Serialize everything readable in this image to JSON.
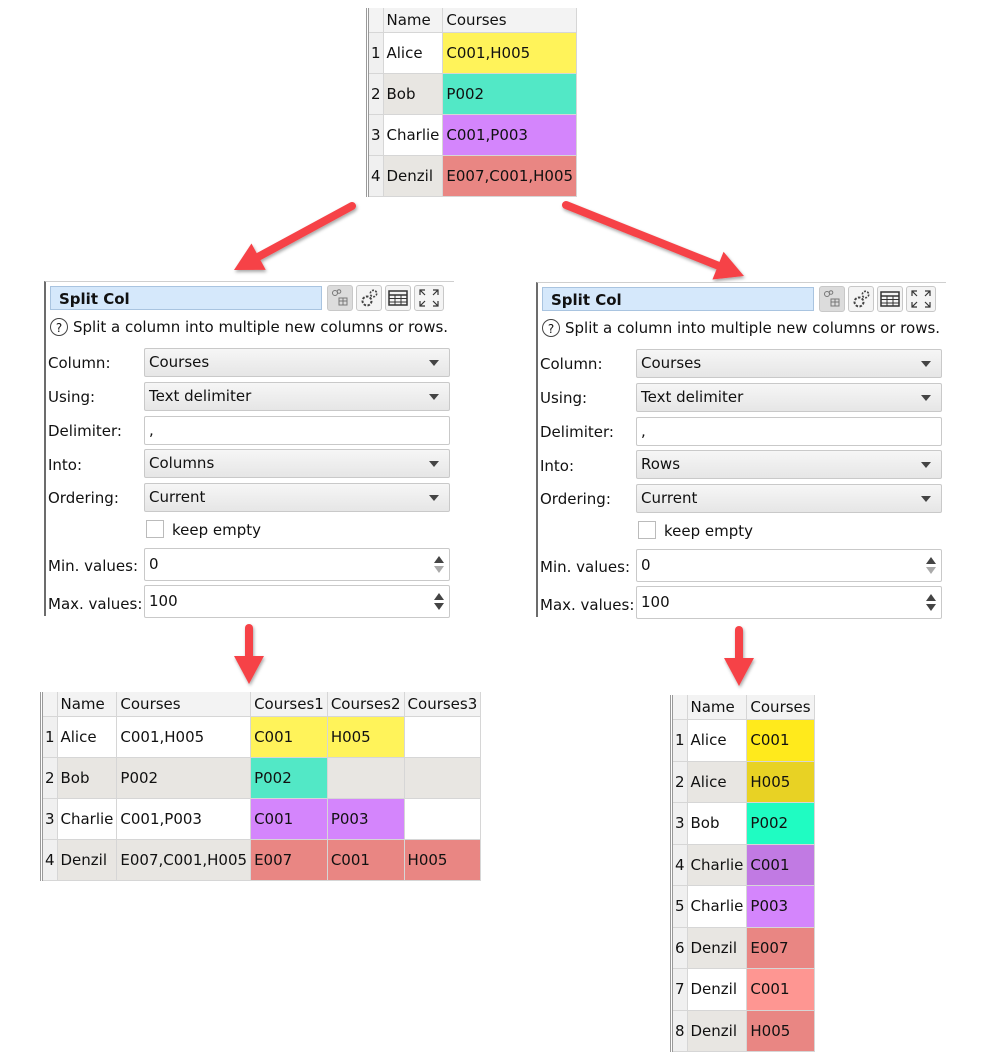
{
  "source_table": {
    "columns": [
      "Name",
      "Courses"
    ],
    "rows": [
      {
        "n": "1",
        "name": "Alice",
        "courses": "C001,H005",
        "color": "#fff35a"
      },
      {
        "n": "2",
        "name": "Bob",
        "courses": "P002",
        "color": "#52e8c6"
      },
      {
        "n": "3",
        "name": "Charlie",
        "courses": "C001,P003",
        "color": "#d485fc"
      },
      {
        "n": "4",
        "name": "Denzil",
        "courses": "E007,C001,H005",
        "color": "#e98683"
      }
    ]
  },
  "dialog_columns": {
    "title": "Split Col",
    "description": "Split a column into multiple new columns or rows.",
    "labels": {
      "column": "Column:",
      "using": "Using:",
      "delimiter": "Delimiter:",
      "into": "Into:",
      "ordering": "Ordering:",
      "min": "Min. values:",
      "max": "Max. values:"
    },
    "column_value": "Courses",
    "using_value": "Text delimiter",
    "delimiter_value": ",",
    "into_value": "Columns",
    "ordering_value": "Current",
    "keep_empty_label": "keep empty",
    "keep_empty_checked": false,
    "min_value": "0",
    "max_value": "100"
  },
  "dialog_rows": {
    "title": "Split Col",
    "description": "Split a column into multiple new columns or rows.",
    "labels": {
      "column": "Column:",
      "using": "Using:",
      "delimiter": "Delimiter:",
      "into": "Into:",
      "ordering": "Ordering:",
      "min": "Min. values:",
      "max": "Max. values:"
    },
    "column_value": "Courses",
    "using_value": "Text delimiter",
    "delimiter_value": ",",
    "into_value": "Rows",
    "ordering_value": "Current",
    "keep_empty_label": "keep empty",
    "keep_empty_checked": false,
    "min_value": "0",
    "max_value": "100"
  },
  "toolbar_icons": [
    "node-table-icon",
    "settings-gears-icon",
    "table-view-icon",
    "maximize-icon"
  ],
  "result_columns_table": {
    "columns": [
      "Name",
      "Courses",
      "Courses1",
      "Courses2",
      "Courses3"
    ],
    "rows": [
      {
        "n": "1",
        "name": "Alice",
        "courses": "C001,H005",
        "c1": "C001",
        "c2": "H005",
        "c3": "",
        "color": "#fff35a",
        "span": 2
      },
      {
        "n": "2",
        "name": "Bob",
        "courses": "P002",
        "c1": "P002",
        "c2": "",
        "c3": "",
        "color": "#52e8c6",
        "span": 1
      },
      {
        "n": "3",
        "name": "Charlie",
        "courses": "C001,P003",
        "c1": "C001",
        "c2": "P003",
        "c3": "",
        "color": "#d485fc",
        "span": 2
      },
      {
        "n": "4",
        "name": "Denzil",
        "courses": "E007,C001,H005",
        "c1": "E007",
        "c2": "C001",
        "c3": "H005",
        "color": "#e98683",
        "span": 3
      }
    ]
  },
  "result_rows_table": {
    "columns": [
      "Name",
      "Courses"
    ],
    "rows": [
      {
        "n": "1",
        "name": "Alice",
        "courses": "C001",
        "color": "#ffea1c"
      },
      {
        "n": "2",
        "name": "Alice",
        "courses": "H005",
        "color": "#e8d224"
      },
      {
        "n": "3",
        "name": "Bob",
        "courses": "P002",
        "color": "#1ffcc2"
      },
      {
        "n": "4",
        "name": "Charlie",
        "courses": "C001",
        "color": "#c17ae3"
      },
      {
        "n": "5",
        "name": "Charlie",
        "courses": "P003",
        "color": "#d485fc"
      },
      {
        "n": "6",
        "name": "Denzil",
        "courses": "E007",
        "color": "#e98683"
      },
      {
        "n": "7",
        "name": "Denzil",
        "courses": "C001",
        "color": "#fe9692"
      },
      {
        "n": "8",
        "name": "Denzil",
        "courses": "H005",
        "color": "#e98683"
      }
    ]
  },
  "arrow_color": "#f64347"
}
